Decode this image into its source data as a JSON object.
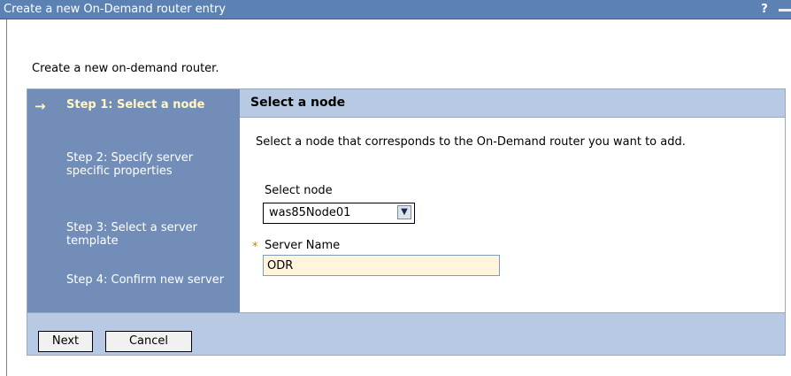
{
  "window": {
    "title": "Create a new On-Demand router entry",
    "help": "?"
  },
  "intro": "Create a new on-demand router.",
  "steps": [
    {
      "label": "Step 1: Select a node",
      "current": true
    },
    {
      "label": "Step 2: Specify server specific properties",
      "current": false
    },
    {
      "label": "Step 3: Select a server template",
      "current": false
    },
    {
      "label": "Step 4: Confirm new server",
      "current": false
    }
  ],
  "panel": {
    "title": "Select a node",
    "description": "Select a node that corresponds to the On-Demand router you want to add.",
    "node_label": "Select node",
    "node_value": "was85Node01",
    "required_mark": "*",
    "server_label": "Server Name",
    "server_value": "ODR"
  },
  "buttons": {
    "next": "Next",
    "cancel": "Cancel"
  },
  "icons": {
    "current_step": "arrow-right-icon",
    "required": "required-asterisk-icon",
    "dropdown": "chevron-down-icon"
  }
}
